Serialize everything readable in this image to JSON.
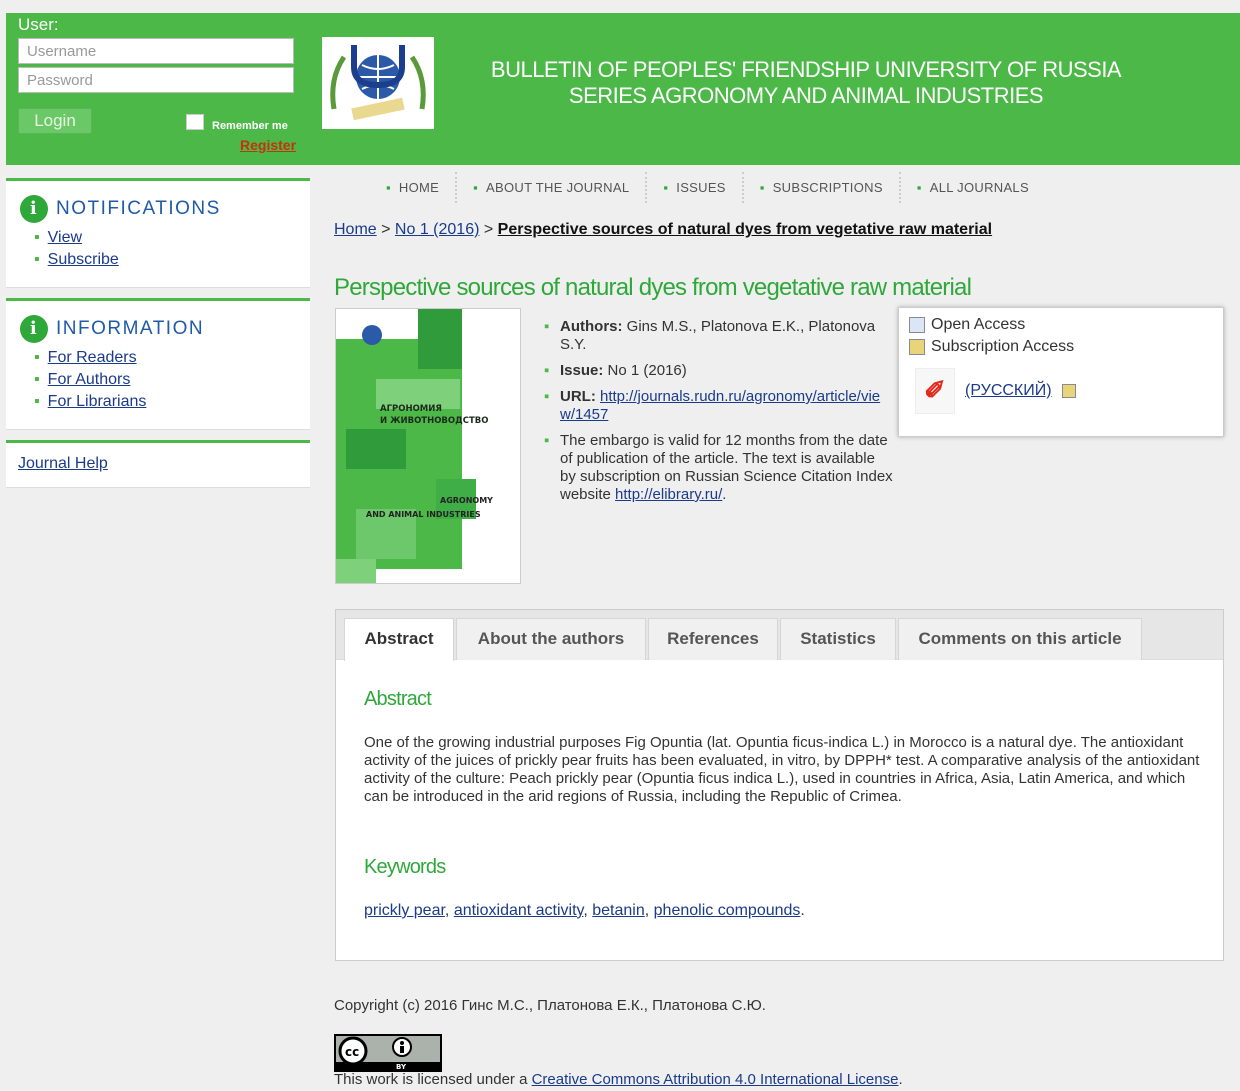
{
  "login": {
    "user_label": "User:",
    "username_placeholder": "Username",
    "password_placeholder": "Password",
    "login_button": "Login",
    "remember_me": "Remember me",
    "register": "Register"
  },
  "header": {
    "journal_title_line1": "BULLETIN OF PEOPLES' FRIENDSHIP UNIVERSITY OF RUSSIA",
    "journal_title_line2": "SERIES AGRONOMY AND ANIMAL INDUSTRIES"
  },
  "sidebar": {
    "notifications": {
      "title": "NOTIFICATIONS",
      "items": [
        "View",
        "Subscribe"
      ]
    },
    "information": {
      "title": "INFORMATION",
      "items": [
        "For Readers",
        "For Authors",
        "For Librarians"
      ]
    },
    "journal_help": "Journal Help"
  },
  "nav": [
    "HOME",
    "ABOUT THE JOURNAL",
    "ISSUES",
    "SUBSCRIPTIONS",
    "ALL JOURNALS"
  ],
  "breadcrumb": {
    "home": "Home",
    "sep1": " > ",
    "issue": "No 1 (2016)",
    "sep2": " > ",
    "current": "Perspective sources of natural dyes from vegetative raw material"
  },
  "article": {
    "title": "Perspective sources of natural dyes from vegetative raw material",
    "authors_label": "Authors:",
    "authors": "Gins M.S., Platonova E.K., Platonova S.Y.",
    "issue_label": "Issue:",
    "issue": "No 1 (2016)",
    "url_label": "URL:",
    "url": "http://journals.rudn.ru/agronomy/article/view/1457",
    "embargo": "The embargo is valid for 12 months from the date of publication of the article. The text is available by subscription on Russian Science Citation Index website",
    "embargo_link": "http://elibrary.ru/",
    "embargo_end": "."
  },
  "cover": {
    "title_ru_1": "АГРОНОМИЯ",
    "title_ru_2": "И ЖИВОТНОВОДСТВО",
    "title_en_1": "AGRONOMY",
    "title_en_2": "AND ANIMAL INDUSTRIES"
  },
  "access": {
    "open": "Open Access",
    "subscription": "Subscription Access",
    "pdf_link": "(РУССКИЙ)"
  },
  "tabs": [
    "Abstract",
    "About the authors",
    "References",
    "Statistics",
    "Comments on this article"
  ],
  "abstract": {
    "title": "Abstract",
    "text": "One of the growing industrial purposes Fig Opuntia (lat. Opuntia ficus-indica L.) in Morocco is a natural dye. The antioxidant activity of the juices of prickly pear fruits has been evaluated, in vitro, by DPPH* test. A comparative analysis of the antioxidant activity of the culture: Peach prickly pear (Opuntia ficus indica L.), used in countries in Africa, Asia, Latin America, and which can be introduced in the arid regions of Russia, including the Republic of Crimea."
  },
  "keywords": {
    "title": "Keywords",
    "items": [
      "prickly pear",
      "antioxidant activity",
      "betanin",
      "phenolic compounds"
    ]
  },
  "footer": {
    "copyright": "Copyright (c) 2016 Гинс М.С., Платонова Е.К., Платонова С.Ю.",
    "license_prefix": "This work is licensed under a ",
    "license_link": "Creative Commons Attribution 4.0 International License",
    "license_suffix": ".",
    "cc_badge_text": "BY"
  },
  "colors": {
    "brand_green": "#4cb848",
    "title_green": "#2fa83a",
    "link_blue": "#1a3a8a",
    "register_red": "#c4330c"
  }
}
